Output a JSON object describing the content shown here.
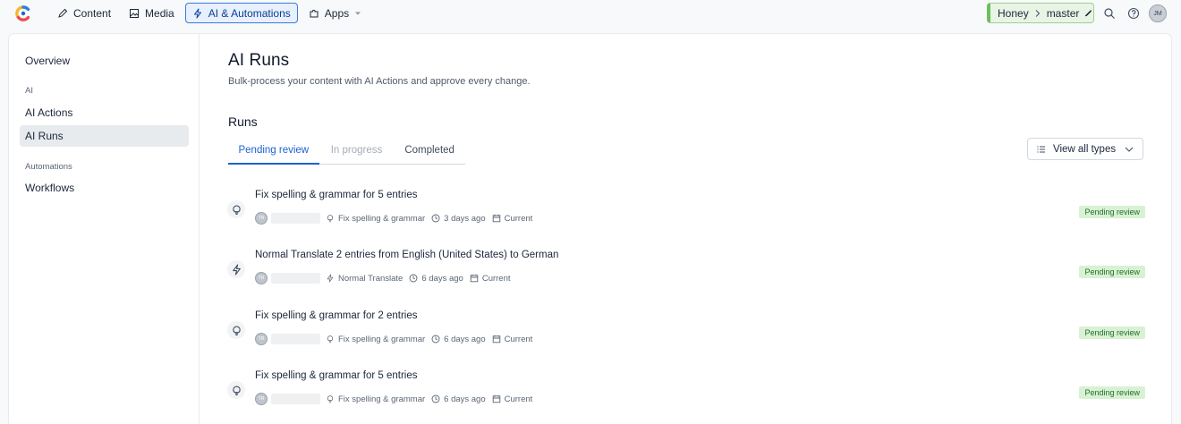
{
  "topbar": {
    "nav": [
      {
        "label": "Content",
        "icon": "pen-icon"
      },
      {
        "label": "Media",
        "icon": "image-icon"
      },
      {
        "label": "AI & Automations",
        "icon": "bolt-icon",
        "active": true
      },
      {
        "label": "Apps",
        "icon": "puzzle-icon"
      }
    ],
    "environment": {
      "space": "Honey",
      "branch": "master"
    },
    "avatar_initials": "JM"
  },
  "sidebar": {
    "overview": "Overview",
    "group_ai": "AI",
    "ai_actions": "AI Actions",
    "ai_runs": "AI Runs",
    "group_automations": "Automations",
    "workflows": "Workflows"
  },
  "main": {
    "title": "AI Runs",
    "subtitle": "Bulk-process your content with AI Actions and approve every change.",
    "section_title": "Runs",
    "tabs": [
      {
        "label": "Pending review",
        "state": "active"
      },
      {
        "label": "In progress",
        "state": "disabled"
      },
      {
        "label": "Completed",
        "state": "normal"
      }
    ],
    "filter_label": "View all types"
  },
  "runs": [
    {
      "title": "Fix spelling & grammar for 5 entries",
      "action": "Fix spelling & grammar",
      "action_icon": "lightbulb-icon",
      "time": "3 days ago",
      "env": "Current",
      "status": "Pending review",
      "avatar": "TR"
    },
    {
      "title": "Normal Translate 2 entries from English (United States) to German",
      "action": "Normal Translate",
      "action_icon": "bolt-icon",
      "time": "6 days ago",
      "env": "Current",
      "status": "Pending review",
      "avatar": "TR"
    },
    {
      "title": "Fix spelling & grammar for 2 entries",
      "action": "Fix spelling & grammar",
      "action_icon": "lightbulb-icon",
      "time": "6 days ago",
      "env": "Current",
      "status": "Pending review",
      "avatar": "TR"
    },
    {
      "title": "Fix spelling & grammar for 5 entries",
      "action": "Fix spelling & grammar",
      "action_icon": "lightbulb-icon",
      "time": "6 days ago",
      "env": "Current",
      "status": "Pending review",
      "avatar": "TR"
    }
  ],
  "colors": {
    "accent": "#1a63cf",
    "badge_bg": "#d9f1d3",
    "badge_text": "#1f6e2c",
    "env_bg": "#e8f5e5"
  }
}
